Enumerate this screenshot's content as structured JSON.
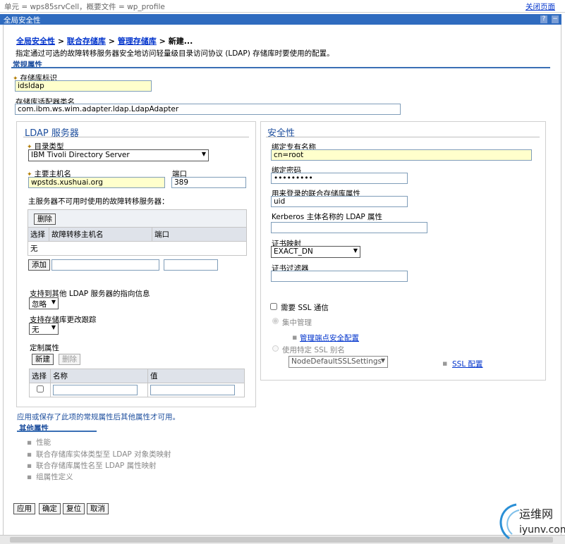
{
  "topbar": {
    "context": "单元 = wps85srvCell，概要文件 = wp_profile",
    "close_page": "关闭页面"
  },
  "window": {
    "title": "全局安全性",
    "help": "?",
    "min": "−"
  },
  "breadcrumb": {
    "items": [
      "全局安全性",
      "联合存储库",
      "管理存储库"
    ],
    "current": "新建...",
    "sep": ">"
  },
  "description": "指定通过可选的故障转移服务器安全地访问轻量级目录访问协议 (LDAP) 存储库时要使用的配置。",
  "general": {
    "section_title": "常规属性",
    "repo_id_label": "存储库标识",
    "repo_id_value": "idsldap",
    "adapter_label": "存储库适配器类名",
    "adapter_value": "com.ibm.ws.wim.adapter.ldap.LdapAdapter"
  },
  "ldap": {
    "title": "LDAP 服务器",
    "dir_type_label": "目录类型",
    "dir_type_value": "IBM Tivoli Directory Server",
    "host_label": "主要主机名",
    "host_value": "wpstds.xushuai.org",
    "port_label": "端口",
    "port_value": "389",
    "failover_label": "主服务器不可用时使用的故障转移服务器：",
    "delete_btn": "删除",
    "failover_cols": [
      "选择",
      "故障转移主机名",
      "端口"
    ],
    "failover_empty": "无",
    "add_btn": "添加",
    "referral_label": "支持到其他 LDAP 服务器的指向信息",
    "referral_value": "忽略",
    "changelog_label": "支持存储库更改跟踪",
    "changelog_value": "无",
    "custom_label": "定制属性",
    "new_btn": "新建",
    "del_btn": "删除",
    "custom_cols": [
      "选择",
      "名称",
      "值"
    ]
  },
  "security": {
    "title": "安全性",
    "bind_dn_label": "绑定专有名称",
    "bind_dn_value": "cn=root",
    "bind_pw_label": "绑定密码",
    "bind_pw_value": "•••••••••",
    "login_attr_label": "用来登录的联合存储库属性",
    "login_attr_value": "uid",
    "kerberos_label": "Kerberos 主体名称的 LDAP 属性",
    "kerberos_value": "",
    "cert_map_label": "证书映射",
    "cert_map_value": "EXACT_DN",
    "cert_filter_label": "证书过滤器",
    "cert_filter_value": "",
    "ssl_label": "需要 SSL 通信",
    "central_label": "集中管理",
    "endpoint_link": "管理端点安全配置",
    "specific_label": "使用特定 SSL 别名",
    "ssl_alias_value": "NodeDefaultSSLSettings",
    "ssl_config_link": "SSL 配置"
  },
  "note": "应用或保存了此项的常规属性后其他属性才可用。",
  "additional": {
    "title": "其他属性",
    "items": [
      "性能",
      "联合存储库实体类型至 LDAP 对象类映射",
      "联合存储库属性名至 LDAP 属性映射",
      "组属性定义"
    ]
  },
  "actions": {
    "apply": "应用",
    "ok": "确定",
    "reset": "复位",
    "cancel": "取消"
  },
  "watermark": {
    "brand": "运维网",
    "domain": "iyunv.com"
  }
}
